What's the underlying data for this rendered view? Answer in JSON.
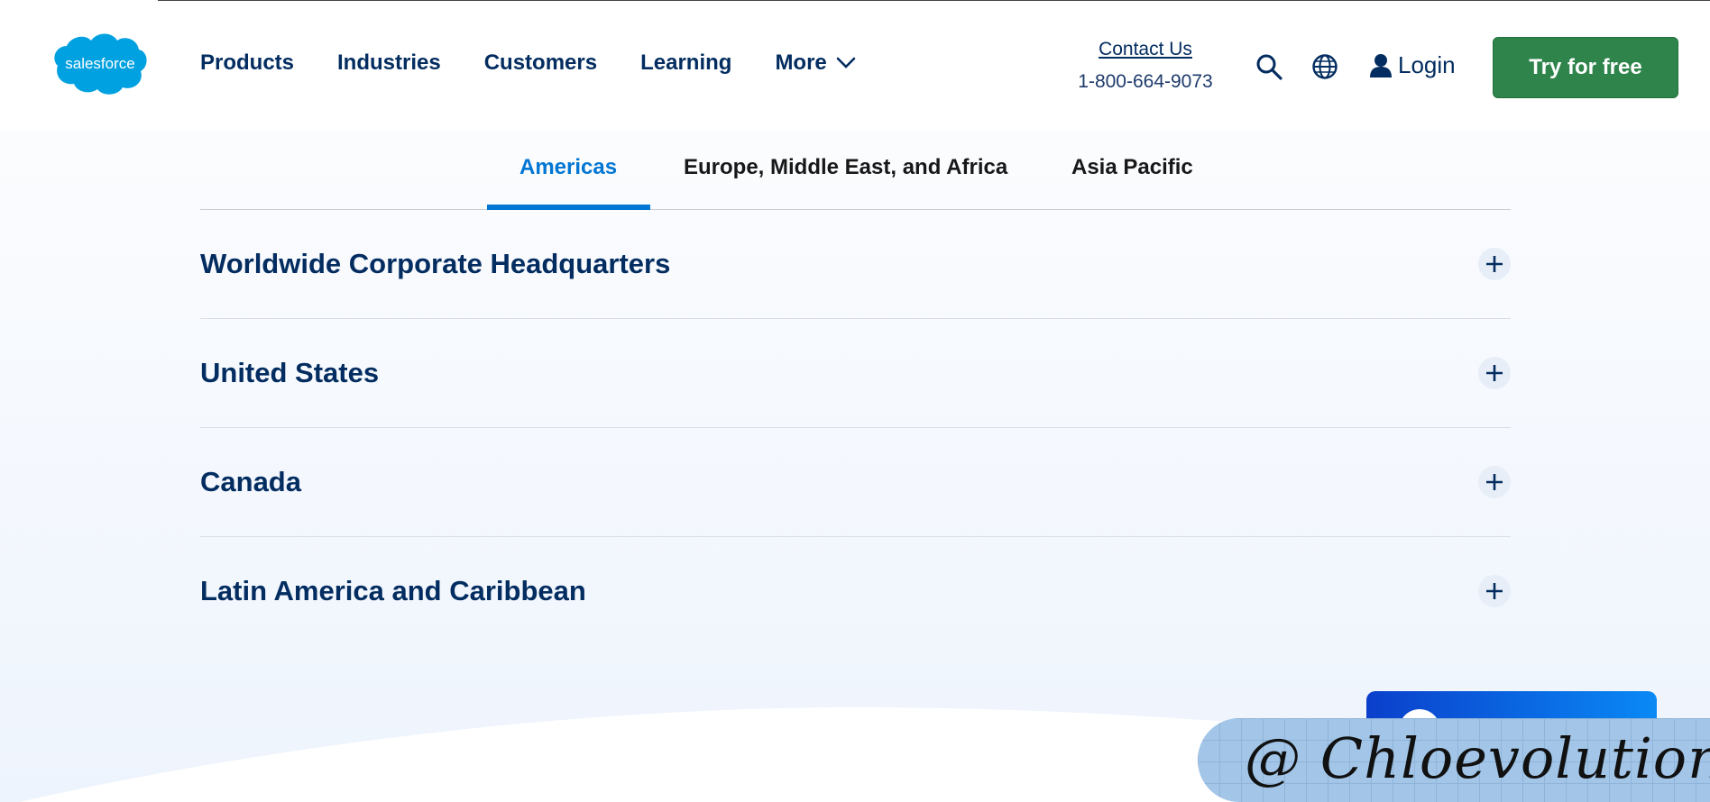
{
  "header": {
    "logo_text": "salesforce",
    "nav": [
      {
        "label": "Products"
      },
      {
        "label": "Industries"
      },
      {
        "label": "Customers"
      },
      {
        "label": "Learning"
      },
      {
        "label": "More",
        "has_dropdown": true
      }
    ],
    "contact_label": "Contact Us",
    "phone": "1-800-664-9073",
    "search_icon": "search-icon",
    "language_icon": "globe-icon",
    "login_label": "Login",
    "cta_label": "Try for free"
  },
  "tabs": {
    "active_index": 0,
    "items": [
      {
        "label": "Americas"
      },
      {
        "label": "Europe, Middle East, and Africa"
      },
      {
        "label": "Asia Pacific"
      }
    ]
  },
  "accordion": [
    {
      "title": "Worldwide Corporate Headquarters"
    },
    {
      "title": "United States"
    },
    {
      "title": "Canada"
    },
    {
      "title": "Latin America and Caribbean"
    }
  ],
  "watermark": "@ Chloevolution",
  "colors": {
    "brand_blue": "#00a1e0",
    "navy": "#032d60",
    "tab_active": "#0176d3",
    "cta_green": "#2e844a"
  }
}
